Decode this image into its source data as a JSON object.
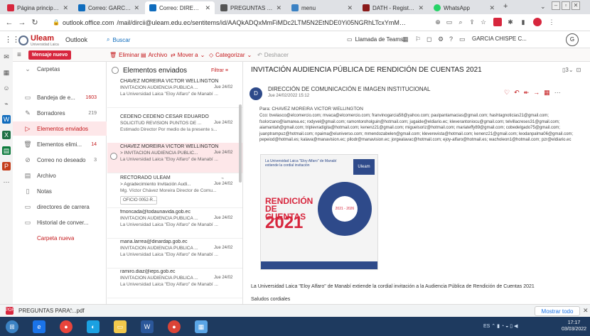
{
  "browser": {
    "tabs": [
      {
        "label": "Página principal de",
        "color": "#d7263d"
      },
      {
        "label": "Correo: GARCIA C",
        "color": "#0f6cbd"
      },
      {
        "label": "Correo: DIRECCIÓ",
        "color": "#0f6cbd"
      },
      {
        "label": "PREGUNTAS PARA",
        "color": "#555555"
      },
      {
        "label": "menu",
        "color": "#3b82c4"
      },
      {
        "label": "DATH - Registro d",
        "color": "#8b1a1a"
      },
      {
        "label": "WhatsApp",
        "color": "#25d366"
      }
    ],
    "new_tab": "+",
    "url_domain": "outlook.office.com",
    "url_path": "/mail/dircii@uleam.edu.ec/sentitems/id/AAQkADQxMmFiMDc2LTM5N2EtNDE0Yi05NGRhLTcxYmM1YzkyMTVkNAAQAOzZEs7yd..."
  },
  "outlook": {
    "logo_text": "Uleam",
    "logo_sub": "Universidad Laica",
    "app_name": "Outlook",
    "search_placeholder": "Buscar",
    "teams_label": "Llamada de Teams",
    "user_label": "GARCIA CHISPE C...",
    "new_mail": "Mensaje nuevo",
    "commands": {
      "delete": "Eliminar",
      "archive": "Archivo",
      "move": "Mover a",
      "categorize": "Categorizar",
      "undo": "Deshacer"
    }
  },
  "folders": {
    "header": "Carpetas",
    "items": [
      {
        "label": "Bandeja de e...",
        "count": "1603",
        "icon": "inbox-icon"
      },
      {
        "label": "Borradores",
        "count": "219",
        "icon": "pencil-icon"
      },
      {
        "label": "Elementos enviados",
        "count": "",
        "icon": "send-icon"
      },
      {
        "label": "Elementos elimi...",
        "count": "14",
        "icon": "trash-icon"
      },
      {
        "label": "Correo no deseado",
        "count": "3",
        "icon": "junk-icon"
      },
      {
        "label": "Archivo",
        "count": "",
        "icon": "archive-icon"
      },
      {
        "label": "Notas",
        "count": "",
        "icon": "note-icon"
      },
      {
        "label": "directores de carrera",
        "count": "",
        "icon": "folder-icon"
      },
      {
        "label": "Historial de conver...",
        "count": "",
        "icon": "folder-icon"
      }
    ],
    "new_folder": "Carpeta nueva"
  },
  "message_list": {
    "title": "Elementos enviados",
    "filter": "Filtrar",
    "messages": [
      {
        "to": "CHAVEZ MOREIRA VICTOR WELLINGTON",
        "subject": "INVITACIÓN AUDIENCIA PÚBLICA ...",
        "date": "Jue 24/02",
        "preview": "La Universidad Laica \"Eloy Alfaro\" de Manabí ...",
        "attachment": ""
      },
      {
        "to": "CEDEÑO CEDEÑO CESAR EDUARDO",
        "subject": "SOLICITUD REVISIÓN PUNTOS DE ...",
        "date": "Jue 24/02",
        "preview": "Estimado Director Por medio de la presente s...",
        "attachment": ""
      },
      {
        "to": "CHAVEZ MOREIRA VICTOR WELLINGTON",
        "subject": "> INVITACIÓN AUDIENCIA PÚBLIC...",
        "date": "Jue 24/02",
        "preview": "La Universidad Laica \"Eloy Alfaro\" de Manabí ...",
        "attachment": ""
      },
      {
        "to": "RECTORADO ULEAM",
        "subject": "> Agradecimiento Invitación Audi...",
        "date": "Jue 24/02",
        "preview": "Mg. Víctor Chávez Moreira Director de Comu...",
        "attachment": "OFICIO 0052-R..."
      },
      {
        "to": "fmoncada@todaunavida.gob.ec",
        "subject": "INVITACIÓN AUDIENCIA PÚBLICA ...",
        "date": "Jue 24/02",
        "preview": "La Universidad Laica \"Eloy Alfaro\" de Manabí ...",
        "attachment": ""
      },
      {
        "to": "maria.larrea@dinardap.gob.ec",
        "subject": "INVITACIÓN AUDIENCIA PÚBLICA ...",
        "date": "Jue 24/02",
        "preview": "La Universidad Laica \"Eloy Alfaro\" de Manabí ...",
        "attachment": ""
      },
      {
        "to": "ramiro.diaz@ieps.gob.ec",
        "subject": "INVITACIÓN AUDIENCIA PÚBLICA ...",
        "date": "Jue 24/02",
        "preview": "La Universidad Laica \"Eloy Alfaro\" de Manabí ...",
        "attachment": ""
      }
    ]
  },
  "reading": {
    "subject": "INVITACIÓN AUDIENCIA PÚBLICA DE RENDICIÓN DE CUENTAS 2021",
    "badge": "3",
    "sender_initial": "D",
    "sender": "DIRECCIÓN DE COMUNICACIÓN E IMAGEN INSTITUCIONAL",
    "date": "Jue 24/02/2022 15:12",
    "to_line": "Para: CHAVEZ MOREIRA VICTOR WELLINGTON",
    "cc_line": "Cco: bvelasco@elcomercio.com; mvaca@elcomercio.com; franvinogarcia58@yahoo.com; paulpantamacias@gmail.com; hashtagnoticias21@gmail.com; fsolorzano@lamarea.ec; rodyvel@gmail.com; ramontoroholguin@hotmail.com; jugaide@eldiario.ec; kleverantoniocu@gmail.com; telvillacreses31@gmail.com; aiamantah@gmail.com; triplevradigita@hotmail.com; kenenz21@gmail.com; miguelsoriz@hotmail.com; mariateffy89@gmail.com; cobedelgado75@gmail.com; juanptrampuz@hotmail.com; npaima@eluniverso.com; mmendozabelen@gmail.com; kleverevista@hotmail.com; kenenz21@gmail.com; leodanpalma06@gmail.com; pepeiod@hotmail.es; kalava@manavision.ec; pilodr@manavision.ec; jorgealavac@hotmail.com; ejoy-alfaro@hotmail.es; wacholeon1@hotmail.com; pzr@eldiario.ec",
    "poster": {
      "top_text": "La Universidad Laica \"Eloy Alfaro\" de Manabí extiende la cordial invitación",
      "logo": "Uleam",
      "title": "RENDICIÓN DE CUENTAS",
      "year": "2021",
      "center": "2021 - 2026"
    },
    "body": "La Universidad Laica \"Eloy Alfaro\" de Manabí extiende la cordial invitación a la Audiencia Pública de Rendición de Cuentas 2021",
    "greeting": "Saludos cordiales"
  },
  "downloads": {
    "file": "PREGUNTAS PARA....pdf",
    "show_all": "Mostrar todo"
  },
  "taskbar": {
    "tray": "ES",
    "time": "17:17",
    "date": "03/03/2022"
  }
}
